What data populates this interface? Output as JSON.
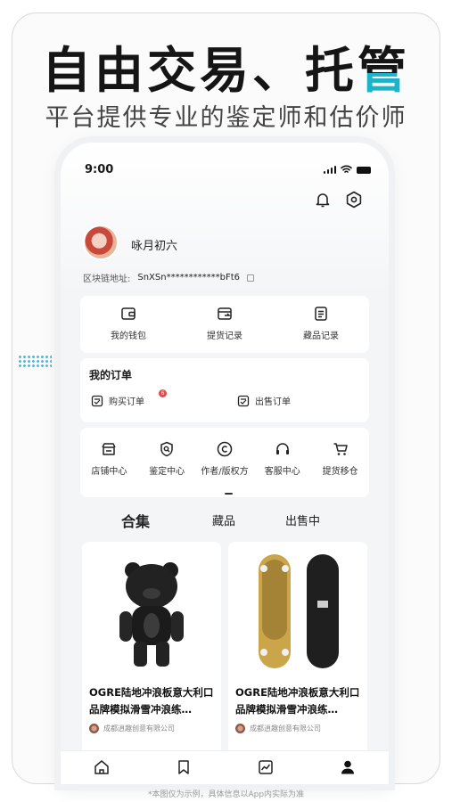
{
  "headline": {
    "main": "自由交易、托",
    "last": "管"
  },
  "subhead": "平台提供专业的鉴定师和估价师",
  "status_bar": {
    "time": "9:00"
  },
  "profile": {
    "name": "咏月初六",
    "chain_label": "区块链地址:",
    "chain_address": "SnXSn************bFt6"
  },
  "quick_links": [
    {
      "label": "我的钱包",
      "icon": "wallet-icon"
    },
    {
      "label": "提货记录",
      "icon": "pickup-record-icon"
    },
    {
      "label": "藏品记录",
      "icon": "collection-record-icon"
    }
  ],
  "orders": {
    "title": "我的订单",
    "buy_label": "购买订单",
    "buy_badge": "6",
    "sell_label": "出售订单"
  },
  "services": [
    {
      "label": "店铺中心",
      "icon": "store-icon"
    },
    {
      "label": "鉴定中心",
      "icon": "appraisal-icon"
    },
    {
      "label": "作者/版权方",
      "icon": "copyright-icon"
    },
    {
      "label": "客服中心",
      "icon": "headset-icon"
    },
    {
      "label": "提货移仓",
      "icon": "cart-icon"
    }
  ],
  "tabs": [
    {
      "label": "合集",
      "active": true
    },
    {
      "label": "藏品",
      "active": false
    },
    {
      "label": "出售中",
      "active": false
    }
  ],
  "products": [
    {
      "title": "OGRE陆地冲浪板意大利口品牌模拟滑雪冲浪练…",
      "seller": "成都逍趣创意有限公司",
      "image": "black-bear-figure"
    },
    {
      "title": "OGRE陆地冲浪板意大利口品牌模拟滑雪冲浪练…",
      "seller": "成都逍趣创意有限公司",
      "image": "surfskate-boards"
    }
  ],
  "tabbar": [
    "home-icon",
    "bookmark-icon",
    "chart-icon",
    "profile-icon"
  ],
  "footnote": "*本图仅为示例，具体信息以App内实际为准",
  "colors": {
    "accent": "#1bb3c8",
    "badge": "#e94848",
    "background": "#f4f5f7"
  }
}
